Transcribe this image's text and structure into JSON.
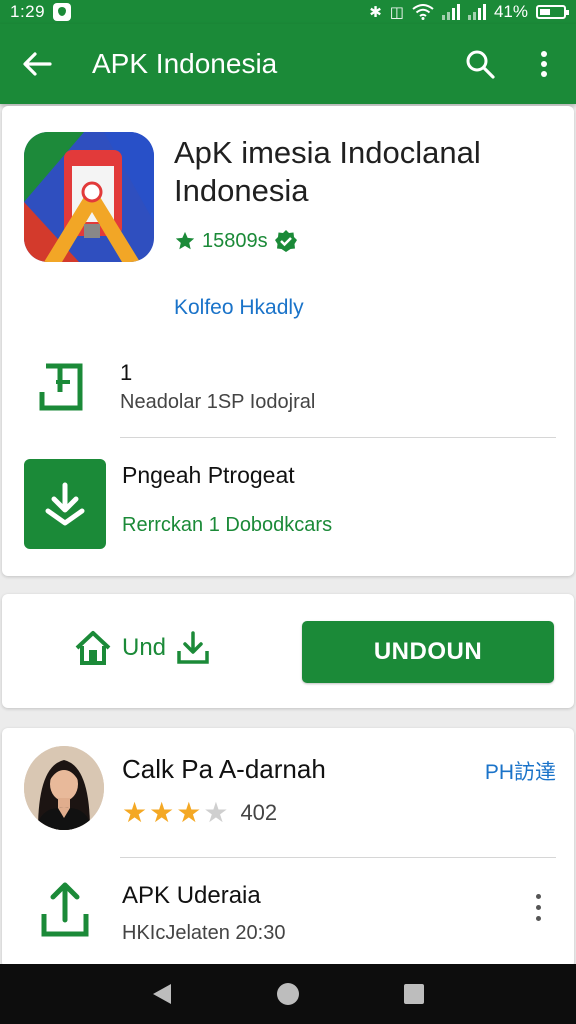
{
  "status_bar": {
    "time": "1:29",
    "battery": "41%"
  },
  "app_bar": {
    "title": "APK Indonesia"
  },
  "app_header": {
    "name": "ApK imesia Indoclanal Indonesia",
    "rating_text": "15809s",
    "link_text": "Kolfeo Hkadly",
    "accent_color": "#1b8a38"
  },
  "info_rows": [
    {
      "title": "1",
      "subtitle": "Neadolar 1SP Iodojral"
    },
    {
      "title": "Pngeah Ptrogeat",
      "subtitle": "Rerrckan 1 Dobodkcars"
    }
  ],
  "install_card": {
    "secondary_label": "Und",
    "button_label": "UNDOUN"
  },
  "review": {
    "author": "Calk Pa A-darnah",
    "badge": "PH訪達",
    "stars_filled": 3,
    "stars_total": 5,
    "count": "402"
  },
  "update_row": {
    "title": "APK Uderaia",
    "subtitle": "HKIcJelaten 20:30"
  },
  "icons": {
    "back": "arrow-left-icon",
    "search": "search-icon",
    "more": "more-vert-icon",
    "verified": "verified-badge-icon",
    "download": "download-icon",
    "share": "share-icon",
    "home": "home-icon"
  }
}
